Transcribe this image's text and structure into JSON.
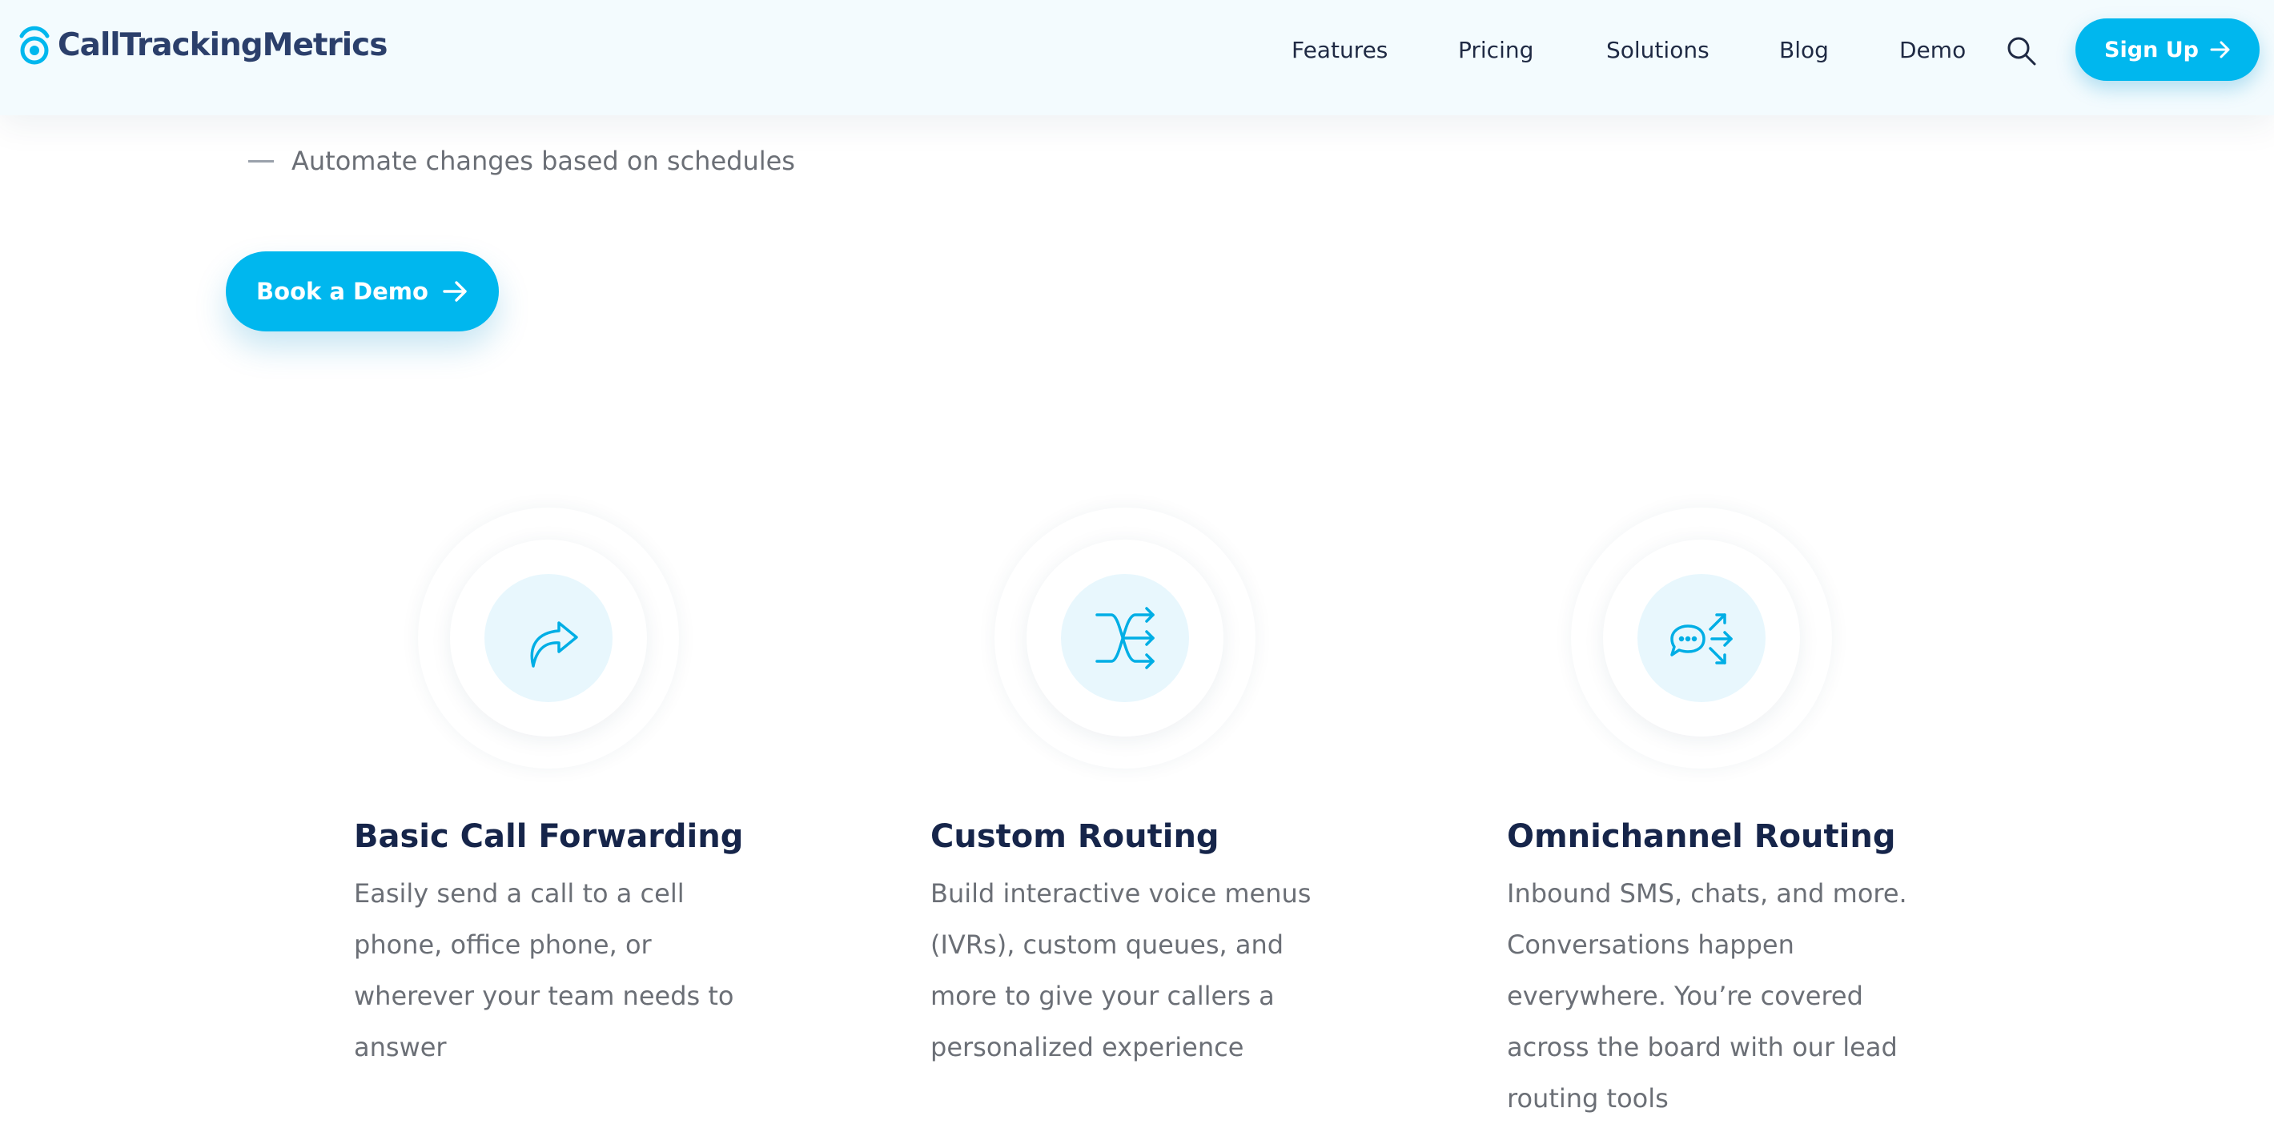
{
  "header": {
    "logo_text": "CallTrackingMetrics",
    "nav": [
      "Features",
      "Pricing",
      "Solutions",
      "Blog",
      "Demo"
    ],
    "search_icon": "search-icon",
    "signup_label": "Sign Up"
  },
  "intro": {
    "bullet": "Automate changes based on schedules",
    "demo_label": "Book a Demo"
  },
  "features": [
    {
      "icon": "forward-arrow-icon",
      "title": "Basic Call Forwarding",
      "description": "Easily send a call to a cell phone, office phone, or wherever your team needs to answer"
    },
    {
      "icon": "shuffle-routing-icon",
      "title": "Custom Routing",
      "description": "Build interactive voice menus (IVRs), custom queues, and more to give your callers a personalized experience"
    },
    {
      "icon": "chat-routing-icon",
      "title": "Omnichannel Routing",
      "description": "Inbound SMS, chats, and more. Conversations happen everywhere. You’re covered across the board with our lead routing tools"
    }
  ],
  "colors": {
    "accent": "#00b7ee",
    "heading": "#16254a",
    "body_text": "#6b6f76",
    "header_bg": "#f3fbfe"
  }
}
